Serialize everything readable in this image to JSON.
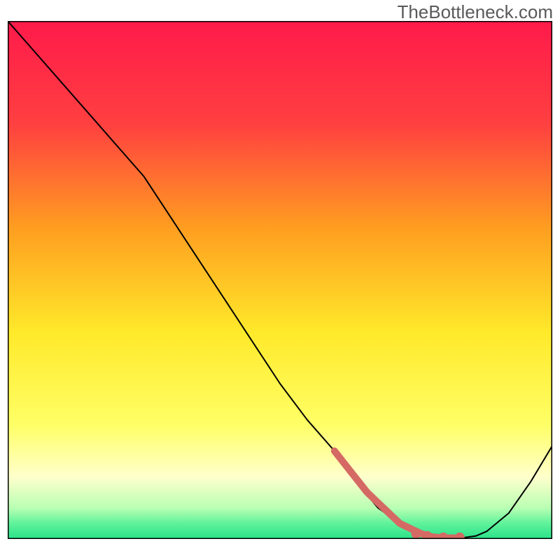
{
  "watermark": "TheBottleneck.com",
  "chart_data": {
    "type": "line",
    "title": "",
    "xlabel": "",
    "ylabel": "",
    "xlim": [
      0,
      100
    ],
    "ylim": [
      0,
      100
    ],
    "grid": false,
    "background_gradient": {
      "type": "vertical",
      "stops": [
        {
          "pos": 0.0,
          "color": "#ff1a4b"
        },
        {
          "pos": 0.2,
          "color": "#ff4040"
        },
        {
          "pos": 0.4,
          "color": "#ff9e20"
        },
        {
          "pos": 0.6,
          "color": "#ffe92a"
        },
        {
          "pos": 0.78,
          "color": "#ffff66"
        },
        {
          "pos": 0.88,
          "color": "#ffffcc"
        },
        {
          "pos": 0.94,
          "color": "#b9ffb3"
        },
        {
          "pos": 0.97,
          "color": "#5ff29b"
        },
        {
          "pos": 1.0,
          "color": "#2ae28a"
        }
      ]
    },
    "series": [
      {
        "name": "bottleneck-curve",
        "color": "#000000",
        "width": 2,
        "x": [
          0,
          5,
          10,
          15,
          20,
          25,
          30,
          35,
          40,
          45,
          50,
          55,
          60,
          64,
          68,
          72,
          74,
          76,
          78,
          80,
          82,
          84,
          86,
          88,
          92,
          96,
          100
        ],
        "y": [
          100,
          94,
          88,
          82,
          76,
          70,
          62,
          54,
          46,
          38,
          30,
          23,
          17,
          11,
          6,
          3,
          2,
          1,
          0.4,
          0.2,
          0.2,
          0.3,
          0.6,
          1.5,
          5,
          11,
          18
        ]
      }
    ],
    "highlight_segment": {
      "name": "optimal-range",
      "color": "#d46a63",
      "width": 10,
      "x": [
        60,
        63,
        66,
        69,
        72,
        74,
        76,
        78,
        80,
        82
      ],
      "y": [
        17,
        13,
        9,
        6,
        3,
        2,
        1,
        0.4,
        0.2,
        0.2
      ]
    },
    "highlight_dots": {
      "name": "optimal-markers",
      "color": "#d46a63",
      "radius": 7,
      "points": [
        {
          "x": 75,
          "y": 1.0
        },
        {
          "x": 77,
          "y": 0.6
        },
        {
          "x": 80,
          "y": 0.3
        },
        {
          "x": 83,
          "y": 0.3
        }
      ]
    }
  }
}
